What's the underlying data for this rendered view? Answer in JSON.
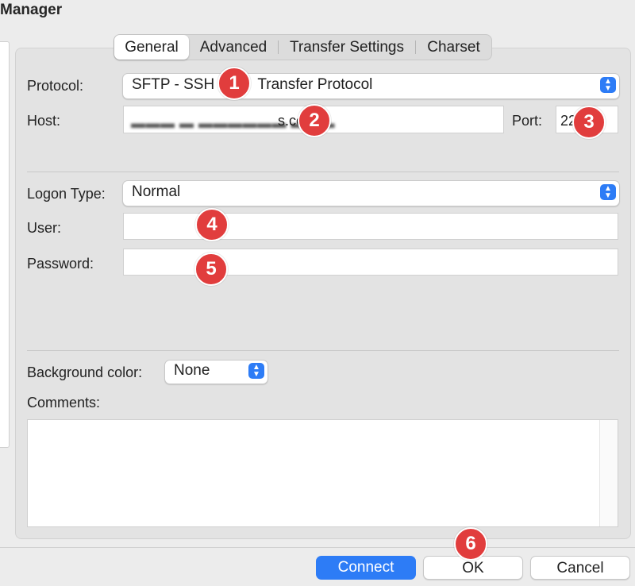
{
  "window": {
    "title": "Manager"
  },
  "tabs": [
    {
      "label": "General",
      "active": true
    },
    {
      "label": "Advanced",
      "active": false
    },
    {
      "label": "Transfer Settings",
      "active": false
    },
    {
      "label": "Charset",
      "active": false
    }
  ],
  "protocol": {
    "label": "Protocol:",
    "value_part1": "SFTP - SSH",
    "value_part2": "Transfer Protocol"
  },
  "host": {
    "label": "Host:",
    "value_visible": "s.co"
  },
  "port": {
    "label": "Port:",
    "value": "22"
  },
  "logon": {
    "label": "Logon Type:",
    "value": "Normal"
  },
  "user": {
    "label": "User:",
    "value": ""
  },
  "password": {
    "label": "Password:",
    "value": ""
  },
  "background": {
    "label": "Background color:",
    "value": "None"
  },
  "comments": {
    "label": "Comments:",
    "value": ""
  },
  "buttons": {
    "connect": "Connect",
    "ok": "OK",
    "cancel": "Cancel"
  },
  "badges": [
    "1",
    "2",
    "3",
    "4",
    "5",
    "6"
  ],
  "colors": {
    "accent": "#2d7cf6",
    "badge": "#e13d3d"
  },
  "icons": {
    "stepper": "up-down-chevron-icon"
  }
}
